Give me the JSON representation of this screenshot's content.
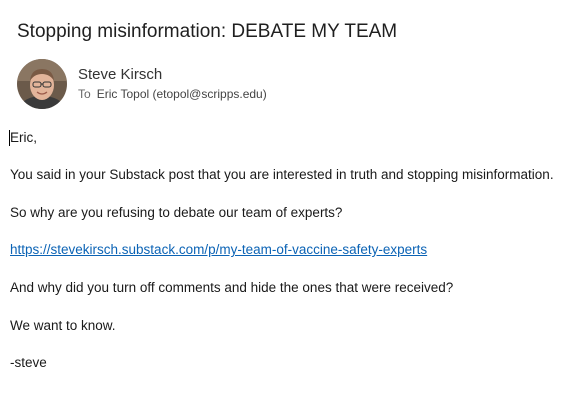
{
  "email": {
    "subject": "Stopping misinformation: DEBATE MY TEAM",
    "sender": {
      "name": "Steve Kirsch",
      "avatar_icon": "profile-photo"
    },
    "to_label": "To",
    "recipient": "Eric Topol (etopol@scripps.edu)",
    "body": {
      "greeting": "Eric,",
      "p1": "You said in your Substack post that you are interested in truth and stopping misinformation.",
      "p2": "So why are you refusing to debate our team of experts?",
      "link": "https://stevekirsch.substack.com/p/my-team-of-vaccine-safety-experts",
      "p3": "And why did you turn off comments and hide the ones that were received?",
      "p4": "We want to know.",
      "signature": "-steve"
    }
  },
  "colors": {
    "link": "#0b63b5",
    "text": "#1a1a1a",
    "background": "#ffffff"
  }
}
